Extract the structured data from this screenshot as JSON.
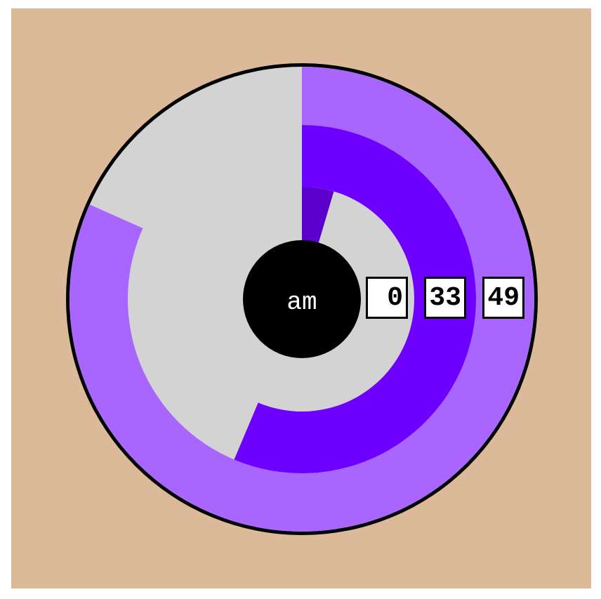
{
  "clock": {
    "period_label": "am",
    "hours": "0",
    "minutes": "33",
    "seconds": "49",
    "hour_fraction": 0.0458,
    "minute_fraction": 0.5636,
    "second_fraction": 0.8167
  },
  "colors": {
    "background": "#dcb999",
    "track": "#d3d3d3",
    "hour_ring": "#5b00cc",
    "minute_ring": "#6e00ff",
    "second_ring": "#a866ff",
    "outline": "#000000",
    "center": "#000000"
  }
}
